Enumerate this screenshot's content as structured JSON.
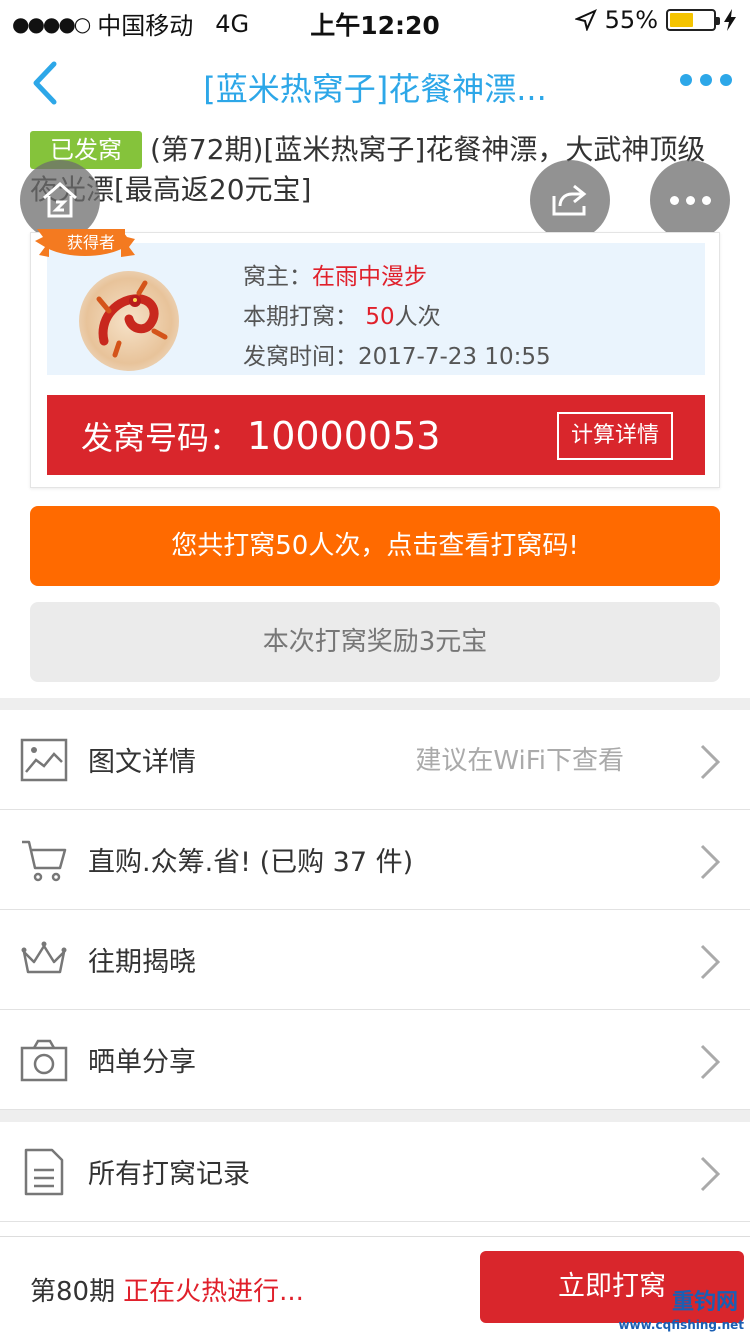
{
  "status_bar": {
    "carrier": "中国移动",
    "network": "4G",
    "time": "上午12:20",
    "battery_percent": "55%",
    "battery_level": 0.55
  },
  "nav": {
    "title": "[蓝米热窝子]花餐神漂..."
  },
  "product": {
    "badge": "已发窝",
    "title": "(第72期)[蓝米热窝子]花餐神漂，大武神顶级夜光漂[最高返20元宝]"
  },
  "winner": {
    "ribbon_label": "获得者",
    "owner_label": "窝主：",
    "owner_name": "在雨中漫步",
    "count_label": "本期打窝：",
    "count_value": "50",
    "count_unit": "人次",
    "time_label": "发窝时间：",
    "time_value": "2017-7-23 10:55",
    "code_label": "发窝号码：",
    "code_value": "10000053",
    "calc_button": "计算详情"
  },
  "actions": {
    "view_codes": "您共打窝50人次，点击查看打窝码!",
    "reward": "本次打窝奖励3元宝"
  },
  "list": [
    {
      "label": "图文详情",
      "hint": "建议在WiFi下查看",
      "icon": "image-icon"
    },
    {
      "label": "直购.众筹.省!  (已购 37 件)",
      "hint": "",
      "icon": "cart-icon"
    },
    {
      "label": "往期揭晓",
      "hint": "",
      "icon": "crown-icon"
    },
    {
      "label": "晒单分享",
      "hint": "",
      "icon": "camera-icon"
    },
    {
      "label": "所有打窝记录",
      "hint": "",
      "icon": "document-icon"
    }
  ],
  "bottom": {
    "period": "第80期",
    "status": "正在火热进行...",
    "join_button": "立即打窝",
    "watermark_name": "重钓网",
    "watermark_url": "www.cqfishing.net"
  },
  "colors": {
    "accent_blue": "#2da7e8",
    "red": "#d9262c",
    "orange": "#ff6a00",
    "green_badge": "#85c33b"
  }
}
